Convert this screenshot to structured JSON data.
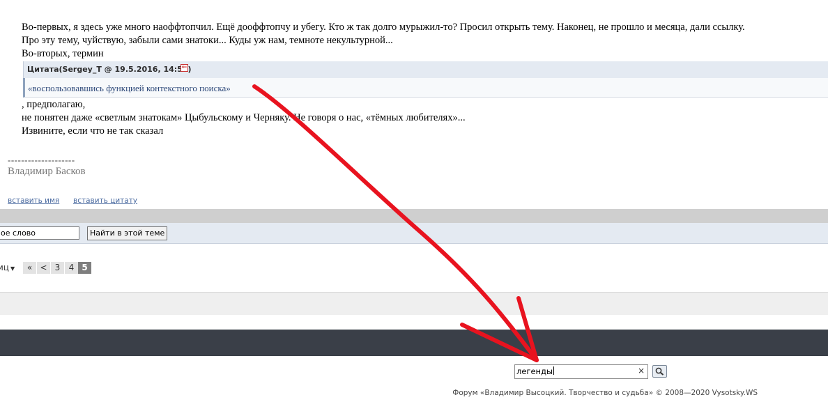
{
  "post": {
    "lines": [
      "Во-первых, я здесь уже много наоффтопчил. Ещё дооффтопчу и убегу. Кто ж так долго мурыжил-то? Просил открыть тему. Наконец, не прошло и месяца, дали ссылку.",
      "Про эту тему, чуйствую, забыли сами знатоки... Куды уж нам, темноте некультурной...",
      "Во-вторых, термин"
    ],
    "quote_header": "Цитата(Sergey_T @ 19.5.2016, 14:51)",
    "quote_text": "«воспользовавшись функцией контекстного поиска»",
    "after_lines": [
      ", предполагаю,",
      "не понятен даже «светлым знатокам» Цыбульскому и Черняку. Не говоря о нас, «тёмных любителях»...",
      "Извините, если что не так сказал"
    ],
    "signature_divider": "--------------------",
    "signature_name": "Владимир Басков",
    "insert_name_link": "вставить имя",
    "insert_quote_link": "вставить цитату"
  },
  "topic_search": {
    "value": "ое слово",
    "button": "Найти в этой теме"
  },
  "pagination": {
    "label": "иц",
    "first": "«",
    "prev": "<",
    "pages": [
      "3",
      "4",
      "5"
    ],
    "current": "5"
  },
  "site_search": {
    "value": "легенды",
    "clear": "×"
  },
  "footer": "Форум «Владимир Высоцкий. Творчество и судьба» © 2008—2020 Vysotsky.WS",
  "colors": {
    "quote_bg": "#e4eaf2",
    "dark_bar": "#3a3f48",
    "annotation_arrow": "#e8131f",
    "link": "#4a6aa0"
  }
}
